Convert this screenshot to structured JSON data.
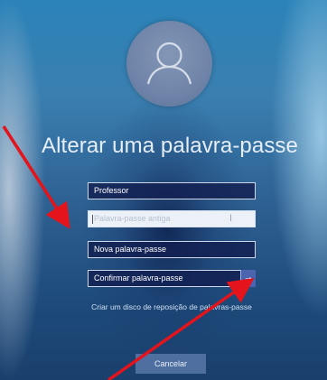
{
  "window": {
    "title": "Alterar uma palavra-passe"
  },
  "avatar": {
    "icon": "user-silhouette-icon"
  },
  "form": {
    "username": "Professor",
    "old_password_placeholder": "Palavra-passe antiga",
    "new_password_placeholder": "Nova palavra-passe",
    "confirm_password_placeholder": "Confirmar palavra-passe",
    "submit_icon": "arrow-right-icon",
    "reset_disk_link": "Criar um disco de reposição de palavras-passe",
    "cancel_label": "Cancelar"
  },
  "annotations": {
    "arrow_color": "#e3141b"
  }
}
